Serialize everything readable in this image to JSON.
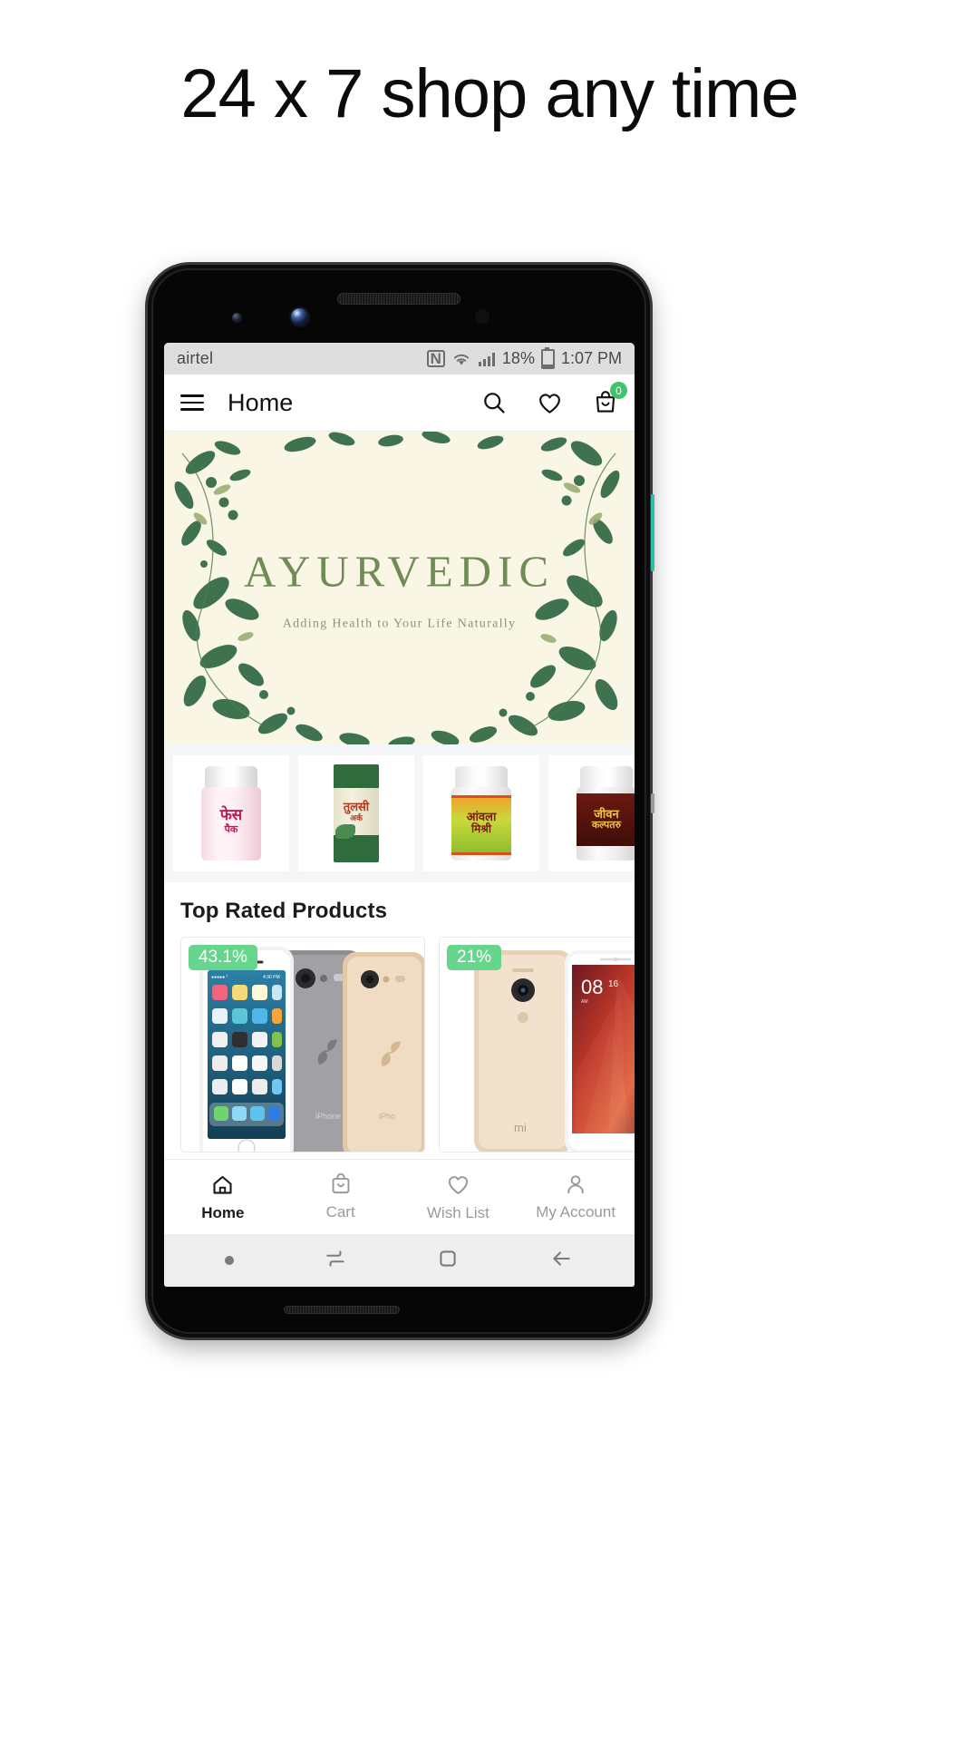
{
  "headline": "24 x 7 shop any time",
  "statusbar": {
    "carrier": "airtel",
    "nfc": "N",
    "wifi_icon": "wifi-icon",
    "signal_icon": "signal-bars-icon",
    "battery_percent": "18%",
    "battery_icon": "battery-icon",
    "time": "1:07 PM"
  },
  "appbar": {
    "menu_icon": "hamburger-menu-icon",
    "title": "Home",
    "search_icon": "search-icon",
    "wishlist_icon": "heart-icon",
    "cart_icon": "shopping-bag-icon",
    "cart_badge": "0"
  },
  "banner": {
    "title": "AYURVEDIC",
    "subtitle": "Adding Health to Your Life Naturally",
    "bg_color": "#FAF6E6",
    "title_color": "#6F8C54",
    "leaf_color": "#3F7350"
  },
  "thumbnails": [
    {
      "name": "face-pack-jar",
      "label": "फेस",
      "label2": "पैक",
      "color": "#f7b9cf"
    },
    {
      "name": "tulsi-ark-box",
      "label": "तुलसी",
      "label2": "अर्क",
      "color": "#2f6b3c"
    },
    {
      "name": "amla-mishri-jar",
      "label": "आंवला",
      "label2": "मिश्री",
      "color": "#a9c83c"
    },
    {
      "name": "jeevan-kalpataru-jar",
      "label": "जीवन",
      "label2": "कल्पतरु",
      "color": "#5a1410"
    }
  ],
  "sections": {
    "top_rated_title": "Top Rated Products"
  },
  "products": [
    {
      "name": "iphone-6s-card",
      "discount": "43.1%",
      "badge_color": "#66D68C"
    },
    {
      "name": "redmi-note-card",
      "discount": "21%",
      "badge_color": "#66D68C"
    }
  ],
  "bottomnav": [
    {
      "icon": "home-icon",
      "label": "Home",
      "active": true
    },
    {
      "icon": "cart-bag-icon",
      "label": "Cart",
      "active": false
    },
    {
      "icon": "heart-icon",
      "label": "Wish List",
      "active": false
    },
    {
      "icon": "person-icon",
      "label": "My Account",
      "active": false
    }
  ],
  "sysnav": {
    "dot": "recent-dot-icon",
    "split": "split-screen-icon",
    "home": "home-square-icon",
    "back": "back-arrow-icon"
  }
}
